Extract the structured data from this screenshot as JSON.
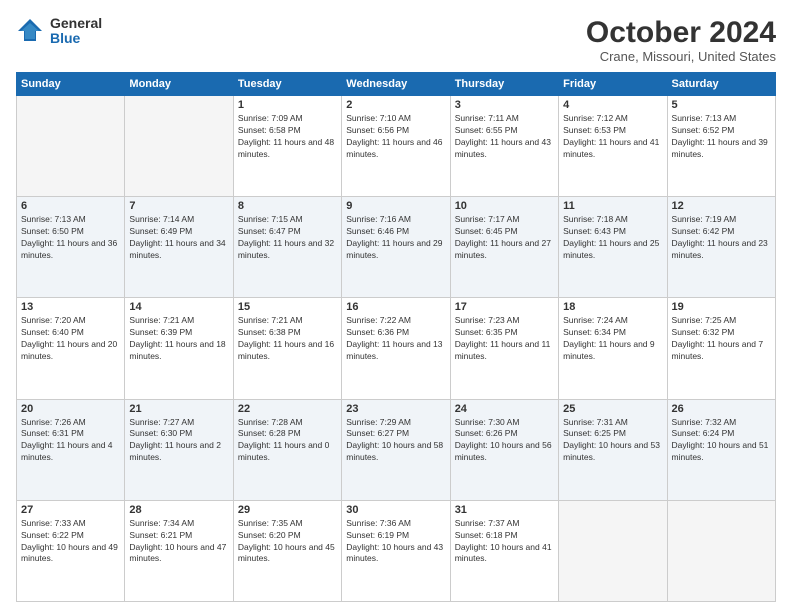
{
  "logo": {
    "general": "General",
    "blue": "Blue"
  },
  "header": {
    "month": "October 2024",
    "location": "Crane, Missouri, United States"
  },
  "weekdays": [
    "Sunday",
    "Monday",
    "Tuesday",
    "Wednesday",
    "Thursday",
    "Friday",
    "Saturday"
  ],
  "weeks": [
    [
      {
        "day": "",
        "info": ""
      },
      {
        "day": "",
        "info": ""
      },
      {
        "day": "1",
        "info": "Sunrise: 7:09 AM\nSunset: 6:58 PM\nDaylight: 11 hours and 48 minutes."
      },
      {
        "day": "2",
        "info": "Sunrise: 7:10 AM\nSunset: 6:56 PM\nDaylight: 11 hours and 46 minutes."
      },
      {
        "day": "3",
        "info": "Sunrise: 7:11 AM\nSunset: 6:55 PM\nDaylight: 11 hours and 43 minutes."
      },
      {
        "day": "4",
        "info": "Sunrise: 7:12 AM\nSunset: 6:53 PM\nDaylight: 11 hours and 41 minutes."
      },
      {
        "day": "5",
        "info": "Sunrise: 7:13 AM\nSunset: 6:52 PM\nDaylight: 11 hours and 39 minutes."
      }
    ],
    [
      {
        "day": "6",
        "info": "Sunrise: 7:13 AM\nSunset: 6:50 PM\nDaylight: 11 hours and 36 minutes."
      },
      {
        "day": "7",
        "info": "Sunrise: 7:14 AM\nSunset: 6:49 PM\nDaylight: 11 hours and 34 minutes."
      },
      {
        "day": "8",
        "info": "Sunrise: 7:15 AM\nSunset: 6:47 PM\nDaylight: 11 hours and 32 minutes."
      },
      {
        "day": "9",
        "info": "Sunrise: 7:16 AM\nSunset: 6:46 PM\nDaylight: 11 hours and 29 minutes."
      },
      {
        "day": "10",
        "info": "Sunrise: 7:17 AM\nSunset: 6:45 PM\nDaylight: 11 hours and 27 minutes."
      },
      {
        "day": "11",
        "info": "Sunrise: 7:18 AM\nSunset: 6:43 PM\nDaylight: 11 hours and 25 minutes."
      },
      {
        "day": "12",
        "info": "Sunrise: 7:19 AM\nSunset: 6:42 PM\nDaylight: 11 hours and 23 minutes."
      }
    ],
    [
      {
        "day": "13",
        "info": "Sunrise: 7:20 AM\nSunset: 6:40 PM\nDaylight: 11 hours and 20 minutes."
      },
      {
        "day": "14",
        "info": "Sunrise: 7:21 AM\nSunset: 6:39 PM\nDaylight: 11 hours and 18 minutes."
      },
      {
        "day": "15",
        "info": "Sunrise: 7:21 AM\nSunset: 6:38 PM\nDaylight: 11 hours and 16 minutes."
      },
      {
        "day": "16",
        "info": "Sunrise: 7:22 AM\nSunset: 6:36 PM\nDaylight: 11 hours and 13 minutes."
      },
      {
        "day": "17",
        "info": "Sunrise: 7:23 AM\nSunset: 6:35 PM\nDaylight: 11 hours and 11 minutes."
      },
      {
        "day": "18",
        "info": "Sunrise: 7:24 AM\nSunset: 6:34 PM\nDaylight: 11 hours and 9 minutes."
      },
      {
        "day": "19",
        "info": "Sunrise: 7:25 AM\nSunset: 6:32 PM\nDaylight: 11 hours and 7 minutes."
      }
    ],
    [
      {
        "day": "20",
        "info": "Sunrise: 7:26 AM\nSunset: 6:31 PM\nDaylight: 11 hours and 4 minutes."
      },
      {
        "day": "21",
        "info": "Sunrise: 7:27 AM\nSunset: 6:30 PM\nDaylight: 11 hours and 2 minutes."
      },
      {
        "day": "22",
        "info": "Sunrise: 7:28 AM\nSunset: 6:28 PM\nDaylight: 11 hours and 0 minutes."
      },
      {
        "day": "23",
        "info": "Sunrise: 7:29 AM\nSunset: 6:27 PM\nDaylight: 10 hours and 58 minutes."
      },
      {
        "day": "24",
        "info": "Sunrise: 7:30 AM\nSunset: 6:26 PM\nDaylight: 10 hours and 56 minutes."
      },
      {
        "day": "25",
        "info": "Sunrise: 7:31 AM\nSunset: 6:25 PM\nDaylight: 10 hours and 53 minutes."
      },
      {
        "day": "26",
        "info": "Sunrise: 7:32 AM\nSunset: 6:24 PM\nDaylight: 10 hours and 51 minutes."
      }
    ],
    [
      {
        "day": "27",
        "info": "Sunrise: 7:33 AM\nSunset: 6:22 PM\nDaylight: 10 hours and 49 minutes."
      },
      {
        "day": "28",
        "info": "Sunrise: 7:34 AM\nSunset: 6:21 PM\nDaylight: 10 hours and 47 minutes."
      },
      {
        "day": "29",
        "info": "Sunrise: 7:35 AM\nSunset: 6:20 PM\nDaylight: 10 hours and 45 minutes."
      },
      {
        "day": "30",
        "info": "Sunrise: 7:36 AM\nSunset: 6:19 PM\nDaylight: 10 hours and 43 minutes."
      },
      {
        "day": "31",
        "info": "Sunrise: 7:37 AM\nSunset: 6:18 PM\nDaylight: 10 hours and 41 minutes."
      },
      {
        "day": "",
        "info": ""
      },
      {
        "day": "",
        "info": ""
      }
    ]
  ]
}
